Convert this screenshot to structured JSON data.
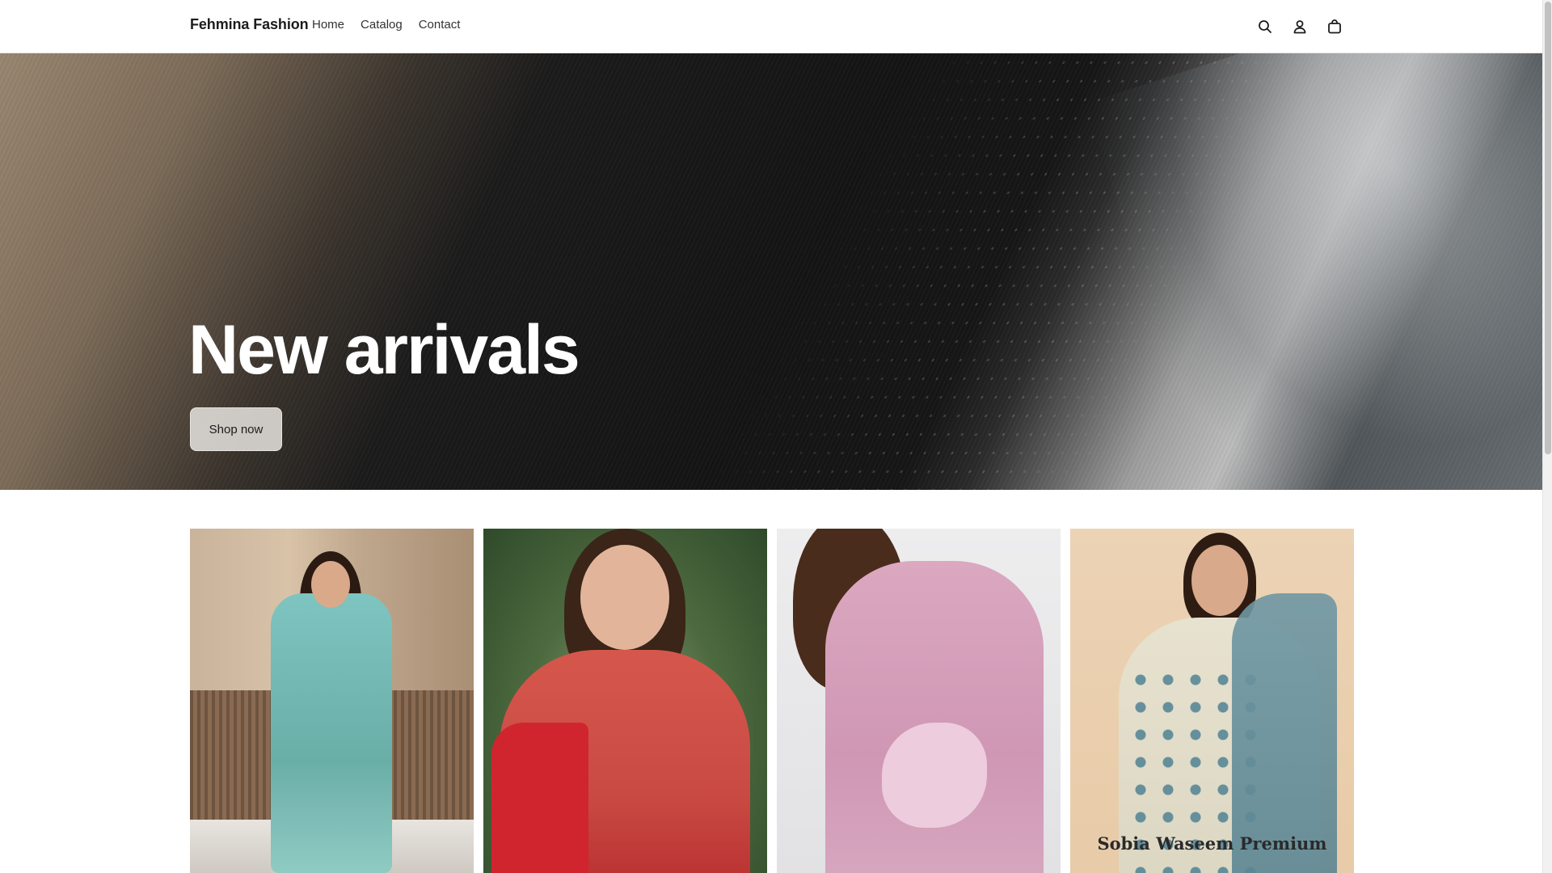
{
  "header": {
    "brand": "Fehmina Fashion",
    "nav": [
      {
        "label": "Home"
      },
      {
        "label": "Catalog"
      },
      {
        "label": "Contact"
      }
    ],
    "icons": [
      "search-icon",
      "account-icon",
      "cart-icon"
    ]
  },
  "hero": {
    "title": "New arrivals",
    "button_label": "Shop now"
  },
  "products": {
    "items": [
      {
        "image": "woman in teal floral long dress"
      },
      {
        "image": "woman in red floral kurta with dupatta"
      },
      {
        "image": "woman in pink embroidered kurta"
      },
      {
        "image": "woman in cream suit with teal floral print",
        "overlay_text": "Sobia Waseem Premium"
      }
    ]
  },
  "colors": {
    "header_bg": "#ffffff",
    "text": "#1c1c1c",
    "hero_text": "#ffffff",
    "button_bg": "#e1ded8"
  }
}
